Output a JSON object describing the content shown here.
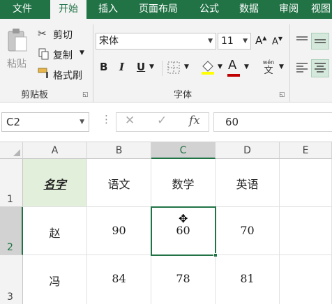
{
  "tabs": [
    "文件",
    "开始",
    "插入",
    "页面布局",
    "公式",
    "数据",
    "审阅",
    "视图"
  ],
  "ribbon": {
    "paste_label": "粘贴",
    "cut_label": "剪切",
    "copy_label": "复制",
    "format_painter_label": "格式刷",
    "clipboard_group": "剪贴板",
    "font_name": "宋体",
    "font_size": "11",
    "font_group": "字体",
    "bold": "B",
    "italic": "I",
    "underline": "U",
    "font_color_glyph": "A",
    "phonetic_top": "wén",
    "phonetic_bottom": "文"
  },
  "formula_bar": {
    "name_box": "C2",
    "fx_label": "fx",
    "value": "60"
  },
  "grid": {
    "columns": [
      "A",
      "B",
      "C",
      "D",
      "E"
    ],
    "selected_column": "C",
    "rows": [
      "1",
      "2",
      "3"
    ],
    "selected_row": "2",
    "cells": [
      [
        "名字",
        "语文",
        "数学",
        "英语",
        ""
      ],
      [
        "赵",
        "90",
        "60",
        "70",
        ""
      ],
      [
        "冯",
        "84",
        "78",
        "81",
        ""
      ]
    ]
  },
  "colors": {
    "accent": "#217346",
    "header_cell_fill": "#e2efda"
  }
}
